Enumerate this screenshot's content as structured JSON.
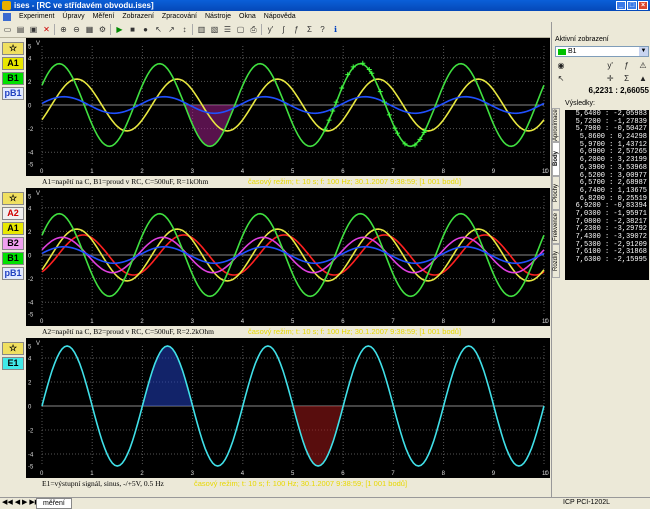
{
  "window": {
    "title": "ises - [RC ve střídavém obvodu.ises]"
  },
  "menu": [
    "Experiment",
    "Úpravy",
    "Měření",
    "Zobrazení",
    "Zpracování",
    "Nástroje",
    "Okna",
    "Nápověda"
  ],
  "panels": [
    {
      "channels": [
        {
          "label": "☆",
          "bg": "#f0e060",
          "fg": "#000"
        },
        {
          "label": "A1",
          "bg": "#e8e800",
          "fg": "#000"
        },
        {
          "label": "B1",
          "bg": "#00e000",
          "fg": "#000"
        },
        {
          "label": "pB1",
          "bg": "#e0e8ff",
          "fg": "#2040c0"
        }
      ],
      "caption": "A1=napětí na C, B1=proud v RC, C=500uF, R=1kOhm",
      "mode": "časový režim; t: 10 s; f: 100 Hz; 30.1.2007  9:38:59; [1 001 bodů]"
    },
    {
      "channels": [
        {
          "label": "☆",
          "bg": "#f0e060",
          "fg": "#000"
        },
        {
          "label": "A2",
          "bg": "#f0f0f0",
          "fg": "#d00000"
        },
        {
          "label": "A1",
          "bg": "#e8e800",
          "fg": "#000"
        },
        {
          "label": "B2",
          "bg": "#f0a0f0",
          "fg": "#000"
        },
        {
          "label": "B1",
          "bg": "#00e000",
          "fg": "#000"
        },
        {
          "label": "pB1",
          "bg": "#e0e8ff",
          "fg": "#2040c0"
        }
      ],
      "caption": "A2=napětí na C, B2=proud v RC, C=500uF, R=2.2kOhm",
      "mode": "časový režim; t: 10 s; f: 100 Hz; 30.1.2007  9:38:59; [1 001 bodů]"
    },
    {
      "channels": [
        {
          "label": "☆",
          "bg": "#f0e060",
          "fg": "#000"
        },
        {
          "label": "E1",
          "bg": "#40e8e8",
          "fg": "#000"
        }
      ],
      "caption": "E1=výstupní signál, sinus, -/+5V, 0.5 Hz",
      "mode": "časový režim; t: 10 s; f: 100 Hz; 30.1.2007  9:38:59; [1 001 bodů]"
    }
  ],
  "axes": {
    "xticks": [
      "0",
      "1",
      "2",
      "3",
      "4",
      "5",
      "6",
      "7",
      "8",
      "9",
      "10"
    ],
    "yticks": [
      "5",
      "4",
      "2",
      "0",
      "-2",
      "-4",
      "-5"
    ],
    "yunit": "V",
    "xunit": "t"
  },
  "right": {
    "active_label": "Aktivní zobrazení",
    "active_value": "B1",
    "coord": "6,2231 : 2,66055",
    "results_label": "Výsledky:",
    "tabs": [
      "Aproximace",
      "Body",
      "Plochy",
      "Frekvence",
      "Rozdíly"
    ],
    "results": [
      "5,6400 : -2,05983",
      "5,7200 : -1,27839",
      "5,7900 : -0,50427",
      "5,8600 : 0,24298",
      "5,9700 : 1,43712",
      "6,0900 : 2,57265",
      "6,2000 : 3,23199",
      "6,3900 : 3,53968",
      "6,5200 : 3,00977",
      "6,5700 : 2,68987",
      "6,7400 : 1,13675",
      "6,8200 : 0,25519",
      "6,9200 : -0,83394",
      "7,0300 : -1,95971",
      "7,0800 : -2,38217",
      "7,2300 : -3,29792",
      "7,4300 : -3,39072",
      "7,5300 : -2,91209",
      "7,6100 : -2,31868",
      "7,6300 : -2,15995"
    ]
  },
  "status": {
    "tab": "měření",
    "device": "ICP PCI-1202L"
  },
  "chart_data": [
    {
      "type": "line",
      "xlim": [
        0,
        10
      ],
      "ylim": [
        -5,
        5
      ],
      "series": [
        {
          "name": "A1",
          "color": "#e8e840",
          "amplitude": 2.2,
          "freq": 0.5,
          "phase": -0.6
        },
        {
          "name": "B1",
          "color": "#40e040",
          "amplitude": 3.5,
          "freq": 0.5,
          "phase": 0.5
        },
        {
          "name": "pB1",
          "color": "#2050ff",
          "amplitude": 0.7,
          "freq": 0.5,
          "phase": 0.2
        }
      ]
    },
    {
      "type": "line",
      "xlim": [
        0,
        10
      ],
      "ylim": [
        -5,
        5
      ],
      "series": [
        {
          "name": "A2",
          "color": "#ff2020",
          "amplitude": 1.7,
          "freq": 0.5,
          "phase": -1.0
        },
        {
          "name": "A1",
          "color": "#e8e840",
          "amplitude": 2.2,
          "freq": 0.5,
          "phase": -0.6
        },
        {
          "name": "B2",
          "color": "#e040e0",
          "amplitude": 1.5,
          "freq": 0.5,
          "phase": 0.3
        },
        {
          "name": "B1",
          "color": "#40e040",
          "amplitude": 3.5,
          "freq": 0.5,
          "phase": 0.5
        },
        {
          "name": "pB1",
          "color": "#2050ff",
          "amplitude": 0.7,
          "freq": 0.5,
          "phase": 0.2
        }
      ]
    },
    {
      "type": "line",
      "xlim": [
        0,
        10
      ],
      "ylim": [
        -5,
        5
      ],
      "series": [
        {
          "name": "E1",
          "color": "#40e0e8",
          "amplitude": 5,
          "freq": 0.5,
          "phase": 0
        }
      ]
    }
  ]
}
